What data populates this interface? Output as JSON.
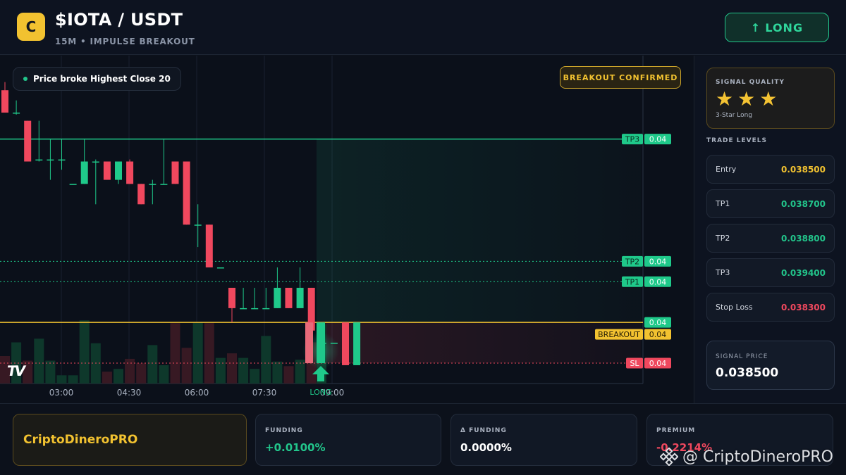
{
  "header": {
    "logo_letter": "C",
    "pair": "$IOTA / USDT",
    "subtitle": "15M • IMPULSE BREAKOUT",
    "long_button": {
      "icon": "arrow-up-icon",
      "arrow": "↑",
      "label": "LONG"
    }
  },
  "chart": {
    "hint": "Price broke Highest Close 20",
    "badge": "BREAKOUT CONFIRMED",
    "long_marker_label": "LONG",
    "tv_logo": "TV",
    "level_tags": [
      {
        "name": "TP3",
        "value": "0.04"
      },
      {
        "name": "TP2",
        "value": "0.04"
      },
      {
        "name": "TP1",
        "value": "0.04"
      },
      {
        "name": "",
        "value": "0.04"
      },
      {
        "name": "BREAKOUT",
        "value": "0.04"
      },
      {
        "name": "SL",
        "value": "0.04"
      }
    ]
  },
  "chart_data": {
    "type": "candlestick",
    "x_ticks": [
      "03:00",
      "04:30",
      "06:00",
      "07:30",
      "09:00"
    ],
    "ylim": [
      0.0382,
      0.03981
    ],
    "levels": {
      "tp3": 0.0394,
      "tp2": 0.0388,
      "tp1": 0.0387,
      "entry": 0.0385,
      "breakout": 0.0385,
      "sl": 0.0383
    },
    "candles": [
      {
        "o": 0.03964,
        "h": 0.03968,
        "l": 0.03953,
        "c": 0.03953
      },
      {
        "o": 0.03953,
        "h": 0.03959,
        "l": 0.03952,
        "c": 0.03953
      },
      {
        "o": 0.03949,
        "h": 0.03949,
        "l": 0.03929,
        "c": 0.03929
      },
      {
        "o": 0.0393,
        "h": 0.03949,
        "l": 0.03929,
        "c": 0.0393
      },
      {
        "o": 0.0393,
        "h": 0.0394,
        "l": 0.0392,
        "c": 0.0393
      },
      {
        "o": 0.0393,
        "h": 0.0394,
        "l": 0.03925,
        "c": 0.0393
      },
      {
        "o": 0.03918,
        "h": 0.03918,
        "l": 0.03918,
        "c": 0.03918
      },
      {
        "o": 0.03918,
        "h": 0.0394,
        "l": 0.03918,
        "c": 0.03929
      },
      {
        "o": 0.03929,
        "h": 0.0393,
        "l": 0.03908,
        "c": 0.03929
      },
      {
        "o": 0.03929,
        "h": 0.03929,
        "l": 0.0392,
        "c": 0.0392
      },
      {
        "o": 0.0392,
        "h": 0.03929,
        "l": 0.03918,
        "c": 0.03929
      },
      {
        "o": 0.03929,
        "h": 0.0393,
        "l": 0.03918,
        "c": 0.03918
      },
      {
        "o": 0.03918,
        "h": 0.03918,
        "l": 0.03908,
        "c": 0.03908
      },
      {
        "o": 0.03918,
        "h": 0.0392,
        "l": 0.03908,
        "c": 0.03918
      },
      {
        "o": 0.03918,
        "h": 0.0394,
        "l": 0.03918,
        "c": 0.03918
      },
      {
        "o": 0.03929,
        "h": 0.03929,
        "l": 0.03918,
        "c": 0.03918
      },
      {
        "o": 0.03929,
        "h": 0.03929,
        "l": 0.03898,
        "c": 0.03898
      },
      {
        "o": 0.03898,
        "h": 0.03908,
        "l": 0.03887,
        "c": 0.03898
      },
      {
        "o": 0.03898,
        "h": 0.03898,
        "l": 0.03877,
        "c": 0.03877
      },
      {
        "o": 0.03877,
        "h": 0.03877,
        "l": 0.03877,
        "c": 0.03877
      },
      {
        "o": 0.03867,
        "h": 0.03867,
        "l": 0.0385,
        "c": 0.03857
      },
      {
        "o": 0.03857,
        "h": 0.03867,
        "l": 0.03857,
        "c": 0.03857
      },
      {
        "o": 0.03857,
        "h": 0.03867,
        "l": 0.03857,
        "c": 0.03857
      },
      {
        "o": 0.03857,
        "h": 0.03867,
        "l": 0.03857,
        "c": 0.03857
      },
      {
        "o": 0.03857,
        "h": 0.03877,
        "l": 0.03857,
        "c": 0.03867
      },
      {
        "o": 0.03867,
        "h": 0.03867,
        "l": 0.03857,
        "c": 0.03857
      },
      {
        "o": 0.03857,
        "h": 0.03877,
        "l": 0.03857,
        "c": 0.03867
      },
      {
        "o": 0.03867,
        "h": 0.03867,
        "l": 0.03846,
        "c": 0.03846
      },
      {
        "o": 0.0384,
        "h": 0.03846,
        "l": 0.03836,
        "c": 0.0384
      },
      {
        "o": 0.0384,
        "h": 0.0384,
        "l": 0.0384,
        "c": 0.0384
      },
      {
        "o": 0.0385,
        "h": 0.0385,
        "l": 0.03829,
        "c": 0.03829
      },
      {
        "o": 0.03829,
        "h": 0.0385,
        "l": 0.03829,
        "c": 0.0385
      }
    ],
    "volume": [
      0.3,
      0.45,
      0.25,
      0.49,
      0.25,
      0.09,
      0.09,
      0.69,
      0.44,
      0.13,
      0.16,
      0.27,
      0.22,
      0.42,
      0.2,
      0.66,
      0.39,
      0.67,
      0.66,
      0.28,
      0.33,
      0.28,
      0.16,
      0.52,
      0.24,
      0.19,
      0.26,
      0.45
    ]
  },
  "panel": {
    "quality_title": "SIGNAL QUALITY",
    "stars": [
      "★",
      "★",
      "★"
    ],
    "quality_sub": "3-Star Long",
    "levels_title": "TRADE LEVELS",
    "levels": [
      {
        "label": "Entry",
        "value": "0.038500",
        "color": "#f2c230"
      },
      {
        "label": "TP1",
        "value": "0.038700",
        "color": "#22c58b"
      },
      {
        "label": "TP2",
        "value": "0.038800",
        "color": "#22c58b"
      },
      {
        "label": "TP3",
        "value": "0.039400",
        "color": "#22c58b"
      },
      {
        "label": "Stop Loss",
        "value": "0.038300",
        "color": "#f0485e"
      }
    ],
    "signal_label": "SIGNAL PRICE",
    "signal_value": "0.038500"
  },
  "footer": {
    "brand": "CriptoDineroPRO",
    "stats": [
      {
        "label": "FUNDING",
        "value": "+0.0100%",
        "color": "#22c58b"
      },
      {
        "label": "Δ FUNDING",
        "value": "0.0000%",
        "color": "#ffffff"
      },
      {
        "label": "PREMIUM",
        "value": "-0.2214%",
        "color": "#f0485e"
      }
    ],
    "watermark": "@ CriptoDineroPRO"
  },
  "colors": {
    "up": "#1fc98a",
    "down": "#f0485e",
    "entry": "#f2c230",
    "accent": "#22c58b"
  }
}
